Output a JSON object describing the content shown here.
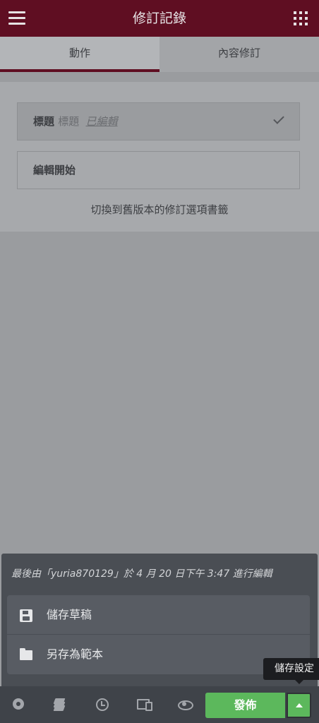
{
  "header": {
    "title": "修訂記錄"
  },
  "tabs": [
    {
      "label": "動作"
    },
    {
      "label": "內容修訂"
    }
  ],
  "revisions": {
    "row1": {
      "label": "標題",
      "sub": "標題",
      "status": "已編輯"
    },
    "row2": {
      "label": "編輯開始"
    },
    "hint": "切換到舊版本的修訂選項書籤"
  },
  "popup": {
    "last_edit": "最後由「yuria870129」於 4 月 20 日下午 3:47 進行編輯",
    "items": [
      {
        "label": "儲存草稿",
        "icon": "save-icon"
      },
      {
        "label": "另存為範本",
        "icon": "folder-icon"
      }
    ]
  },
  "tooltip": "儲存設定",
  "footer": {
    "icons": [
      "settings-icon",
      "layers-icon",
      "history-icon",
      "responsive-icon",
      "eye-icon"
    ],
    "publish_label": "發佈"
  },
  "colors": {
    "header": "#5f0e22",
    "publish": "#5cb85c",
    "popup": "#4a4e54"
  }
}
